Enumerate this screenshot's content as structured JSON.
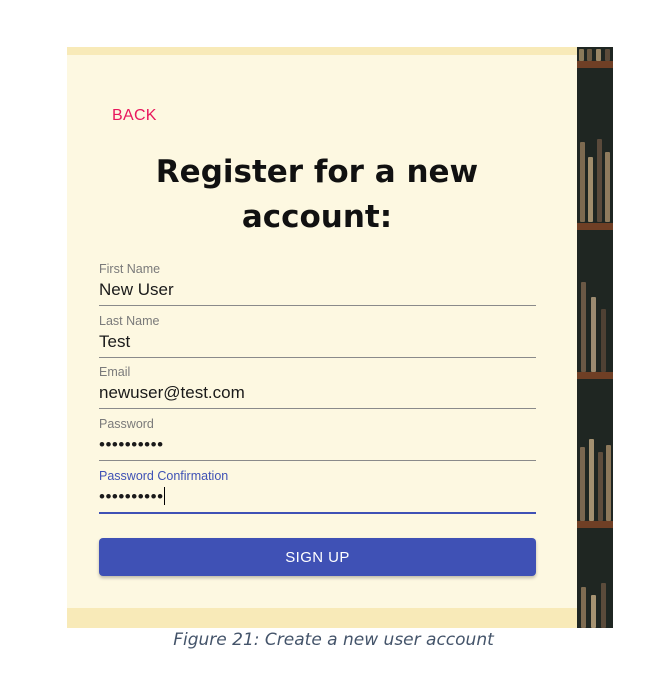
{
  "back_label": "BACK",
  "title_line1": "Register for a new",
  "title_line2": "account:",
  "fields": [
    {
      "label": "First Name",
      "value": "New User"
    },
    {
      "label": "Last Name",
      "value": "Test"
    },
    {
      "label": "Email",
      "value": "newuser@test.com"
    },
    {
      "label": "Password",
      "value": "••••••••••"
    },
    {
      "label": "Password Confirmation",
      "value": "••••••••••"
    }
  ],
  "signup_label": "SIGN UP",
  "caption": "Figure 21: Create a new user account",
  "colors": {
    "accent": "#3f51b5",
    "back": "#e8175d",
    "panel": "#fdf8e1"
  }
}
